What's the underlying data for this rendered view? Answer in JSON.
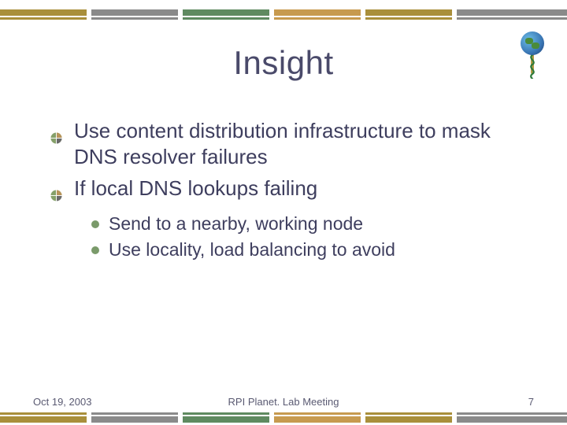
{
  "title": "Insight",
  "bullets": {
    "main": [
      "Use content distribution infrastructure to mask DNS resolver failures",
      "If local DNS lookups failing"
    ],
    "sub": [
      "Send to a nearby, working node",
      "Use locality, load balancing to avoid"
    ]
  },
  "footer": {
    "date": "Oct 19, 2003",
    "venue": "RPI Planet. Lab Meeting",
    "page": "7"
  },
  "colors": {
    "band": [
      "#a98f3b",
      "#8a8a8a",
      "#5f8a60",
      "#c79a4f",
      "#a98f3b",
      "#8a8a8a"
    ],
    "text": "#3e3e5e",
    "sub_bullet": "#7a9a6a"
  },
  "logo": {
    "name": "globe-caduceus-icon"
  }
}
